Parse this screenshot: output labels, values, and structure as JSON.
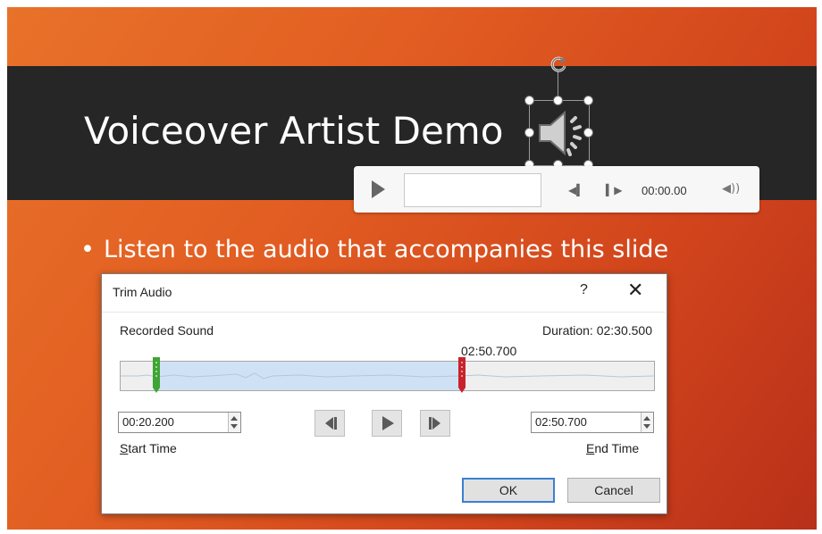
{
  "slide": {
    "title": "Voiceover Artist Demo",
    "bullet": "Listen to the audio that accompanies this slide",
    "bullet_marker": "•"
  },
  "player": {
    "time": "00:00.00",
    "icons": [
      "play-icon",
      "step-back-icon",
      "step-forward-icon",
      "volume-icon"
    ]
  },
  "dialog": {
    "title": "Trim Audio",
    "help": "?",
    "close": "✕",
    "sound_name": "Recorded Sound",
    "duration": "Duration: 02:30.500",
    "marker_time": "02:50.700",
    "start_time_value": "00:20.200",
    "end_time_value": "02:50.700",
    "start_label_accel": "S",
    "start_label_rest": "tart Time",
    "end_label_accel": "E",
    "end_label_rest": "nd Time",
    "ok": "OK",
    "cancel": "Cancel",
    "colors": {
      "start_marker": "#3fa535",
      "end_marker": "#c8232a",
      "selection": "#cfe2f5"
    }
  }
}
